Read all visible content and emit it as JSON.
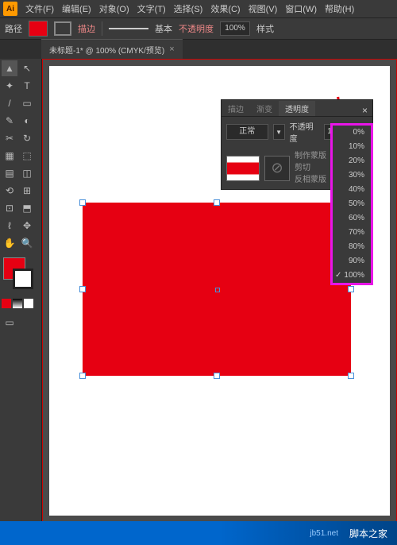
{
  "menu": {
    "items": [
      "文件(F)",
      "编辑(E)",
      "对象(O)",
      "文字(T)",
      "选择(S)",
      "效果(C)",
      "视图(V)",
      "窗口(W)",
      "帮助(H)"
    ],
    "app": "Ai"
  },
  "options": {
    "label": "路径",
    "stroke_label": "描边",
    "basic": "基本",
    "opacity_label": "不透明度",
    "opacity_value": "100%",
    "style": "样式"
  },
  "doc": {
    "tab": "未标题-1* @ 100% (CMYK/预览)",
    "close": "×"
  },
  "panel": {
    "tabs": [
      "描边",
      "渐变",
      "透明度"
    ],
    "blend_label": "正常",
    "opacity_label": "不透明度",
    "opacity_value": "100%",
    "make_mask": "制作蒙版",
    "clip": "剪切",
    "invert": "反相蒙版"
  },
  "opacity_options": [
    "0%",
    "10%",
    "20%",
    "30%",
    "40%",
    "50%",
    "60%",
    "70%",
    "80%",
    "90%",
    "100%"
  ],
  "opacity_selected": "100%",
  "tools": [
    "▲",
    "↖",
    "✦",
    "T",
    "/",
    "▭",
    "✎",
    "◐",
    "✂",
    "↻",
    "▦",
    "⬚",
    "▤",
    "◫",
    "⟲",
    "⊞",
    "⊡",
    "⬒",
    "ℓ",
    "✥",
    "✋",
    "🔍"
  ],
  "footer": {
    "site": "jb51.net",
    "brand": "脚本之家"
  }
}
